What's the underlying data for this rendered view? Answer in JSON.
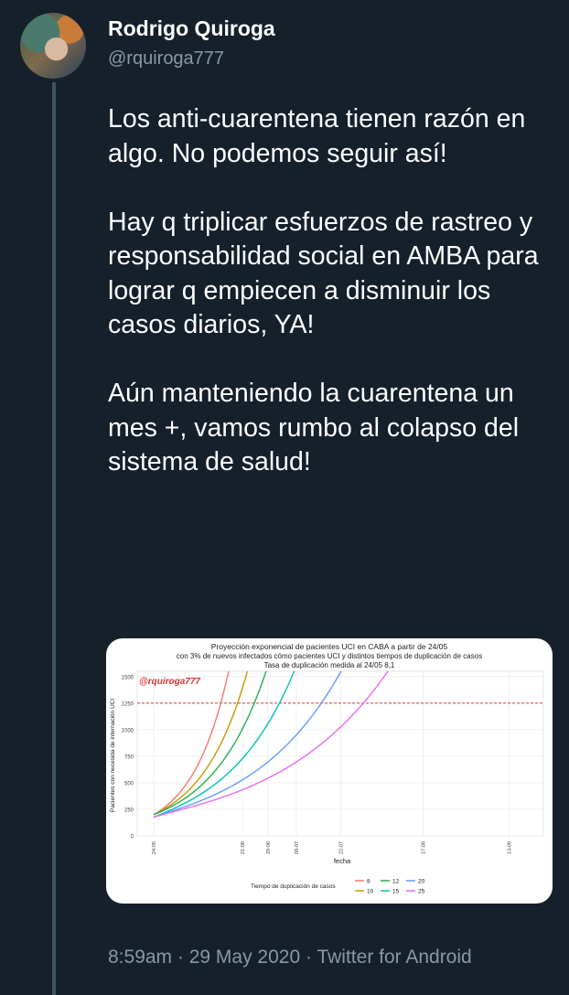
{
  "author": {
    "name": "Rodrigo Quiroga",
    "handle": "@rquiroga777"
  },
  "tweet": {
    "paragraphs": [
      "Los anti-cuarentena tienen razón en algo. No podemos seguir así!",
      "Hay q triplicar esfuerzos de rastreo y responsabilidad social en AMBA para lograr q empiecen a disminuir los casos diarios, YA!",
      "Aún manteniendo la cuarentena un mes +, vamos rumbo al colapso del sistema de salud!"
    ],
    "time": "8:59am",
    "date": "29 May 2020",
    "source": "Twitter for Android",
    "separator": "·"
  },
  "chart_data": {
    "type": "line",
    "title": "Proyección exponencial de pacientes UCI en CABA a partir de 24/05",
    "subtitle": "con 3% de nuevos infectados cómo pacientes UCI y distintos tiempos de duplicación de casos",
    "subtitle2": "Tasa de duplicación medida al 24/05 8,1",
    "watermark": "@rquiroga777",
    "xlabel": "fecha",
    "ylabel": "Pacientes con necesida de internación UCI",
    "x_ticks": [
      "24-05",
      "21-06",
      "29-06",
      "08-07",
      "22-07",
      "17-08",
      "13-09"
    ],
    "y_ticks": [
      0,
      250,
      500,
      750,
      1000,
      1250,
      1500
    ],
    "ylim": [
      0,
      1550
    ],
    "threshold": 1250,
    "legend_title": "Tiempo de duplicación de casos",
    "grid": true,
    "series": [
      {
        "name": "8",
        "color": "#f8766d",
        "doubling_days": 8
      },
      {
        "name": "10",
        "color": "#c49a00",
        "doubling_days": 10
      },
      {
        "name": "12",
        "color": "#22b14c",
        "doubling_days": 12
      },
      {
        "name": "15",
        "color": "#00c0b8",
        "doubling_days": 15
      },
      {
        "name": "20",
        "color": "#619cff",
        "doubling_days": 20
      },
      {
        "name": "25",
        "color": "#e76bf3",
        "doubling_days": 25
      }
    ]
  }
}
